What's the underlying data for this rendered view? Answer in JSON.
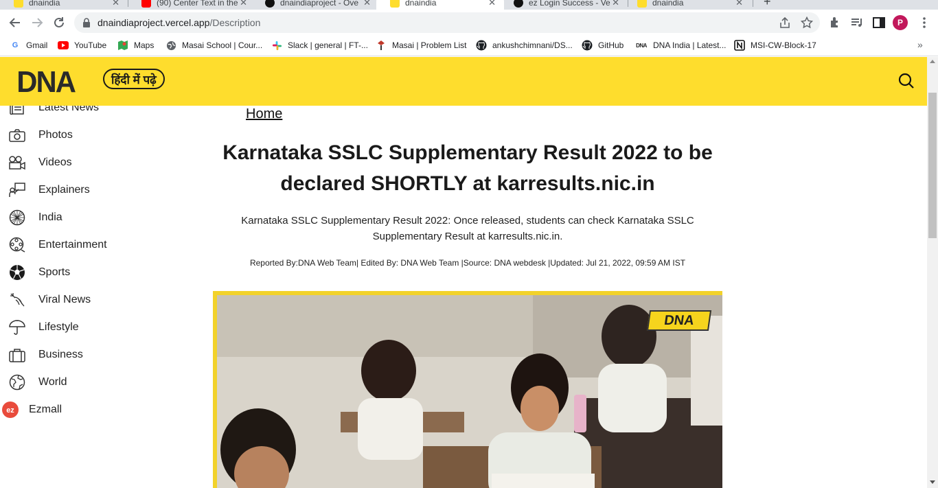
{
  "browser": {
    "tabs": [
      {
        "title": "dnaindia",
        "favicon_color": "#fedd2d"
      },
      {
        "title": "(90) Center Text in the",
        "favicon_color": "#ff0000"
      },
      {
        "title": "dnaindiaproject - Ove",
        "favicon_color": "#111111"
      },
      {
        "title": "dnaindia",
        "favicon_color": "#fedd2d"
      },
      {
        "title": "ez Login Success - Ve",
        "favicon_color": "#111111"
      },
      {
        "title": "dnaindia",
        "favicon_color": "#fedd2d"
      }
    ],
    "url_host": "dnaindiaproject.vercel.app",
    "url_path": "/Description",
    "profile_initial": "P"
  },
  "bookmarks": [
    {
      "label": "Gmail",
      "icon": "google-icon"
    },
    {
      "label": "YouTube",
      "icon": "youtube-icon"
    },
    {
      "label": "Maps",
      "icon": "maps-icon"
    },
    {
      "label": "Masai School | Cour...",
      "icon": "globe-icon"
    },
    {
      "label": "Slack | general | FT-...",
      "icon": "slack-icon"
    },
    {
      "label": "Masai | Problem List",
      "icon": "masai-icon"
    },
    {
      "label": "ankushchimnani/DS...",
      "icon": "github-icon"
    },
    {
      "label": "GitHub",
      "icon": "github-icon"
    },
    {
      "label": "DNA India | Latest...",
      "icon": "dna-icon"
    },
    {
      "label": "MSI-CW-Block-17",
      "icon": "notion-icon"
    }
  ],
  "header": {
    "logo": "DNA",
    "hindi_button": "हिंदी में पढ़े"
  },
  "sidebar": {
    "items": [
      {
        "label": "Latest News",
        "icon": "newspaper-icon"
      },
      {
        "label": "Photos",
        "icon": "camera-icon"
      },
      {
        "label": "Videos",
        "icon": "video-camera-icon"
      },
      {
        "label": "Explainers",
        "icon": "presenter-icon"
      },
      {
        "label": "India",
        "icon": "ashoka-chakra-icon"
      },
      {
        "label": "Entertainment",
        "icon": "film-reel-icon"
      },
      {
        "label": "Sports",
        "icon": "football-icon"
      },
      {
        "label": "Viral News",
        "icon": "viral-icon"
      },
      {
        "label": "Lifestyle",
        "icon": "umbrella-icon"
      },
      {
        "label": "Business",
        "icon": "briefcase-icon"
      },
      {
        "label": "World",
        "icon": "globe-icon"
      },
      {
        "label": "Ezmall",
        "icon": "ezmall-icon"
      }
    ]
  },
  "article": {
    "breadcrumb": "Home",
    "title": "Karnataka SSLC Supplementary Result 2022 to be declared SHORTLY at karresults.nic.in",
    "summary": "Karnataka SSLC Supplementary Result 2022: Once released, students can check Karnataka SSLC Supplementary Result at karresults.nic.in.",
    "byline": "Reported By:DNA Web Team| Edited By: DNA Web Team |Source: DNA webdesk |Updated: Jul 21, 2022, 09:59 AM IST",
    "image_badge": "DNA"
  },
  "colors": {
    "brand_yellow": "#fedd2d",
    "text": "#1a1a1a"
  }
}
